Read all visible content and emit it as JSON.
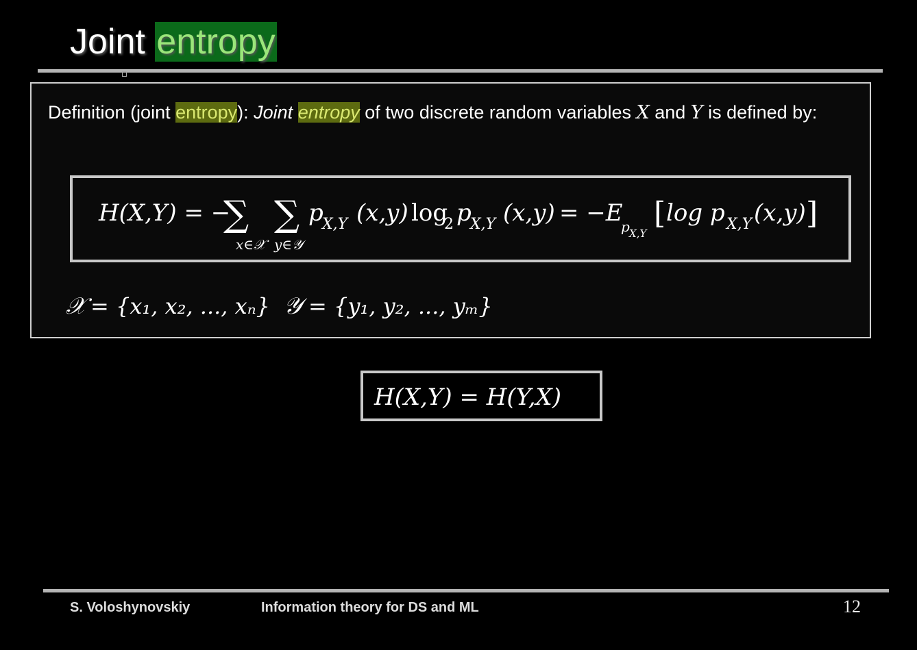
{
  "slide": {
    "title_plain": "Joint",
    "title_highlight": "entropy",
    "page_number": "12"
  },
  "definition": {
    "label_prefix": "Definition (joint ",
    "label_highlight": "entropy",
    "label_suffix": "): ",
    "italic_word": "Joint",
    "italic_highlight": "entropy",
    "text_middle": " of two discrete random variables ",
    "var_x": "X",
    "text_and": " and ",
    "var_y": "Y",
    "text_end": " is defined by:"
  },
  "formula_main": {
    "lhs": "H(X,Y) = −",
    "sum_x_sub": "x∈𝒳",
    "sum_y_sub": "y∈𝒴",
    "term1": "p",
    "term1_sub": "X,Y",
    "term1_arg": "(x,y)",
    "log_base": "log",
    "log_sub": "2",
    "term2": "p",
    "term2_sub": "X,Y",
    "term2_arg": "(x,y)",
    "equals_neg": "= −E",
    "expect_sub": "p",
    "expect_sub_sub": "X,Y",
    "bracket_content": "log p",
    "bracket_sub": "X,Y",
    "bracket_arg": "(x,y)"
  },
  "alphabets": {
    "x_set_name": "𝒳",
    "x_set_body": "= {x₁, x₂, ..., xₙ}",
    "y_set_name": "𝒴",
    "y_set_body": "= {y₁, y₂, ..., yₘ}"
  },
  "symmetry": {
    "text": "H(X,Y) = H(Y,X)"
  },
  "footer": {
    "author": "S. Voloshynovskiy",
    "course": "Information theory for DS and ML"
  }
}
